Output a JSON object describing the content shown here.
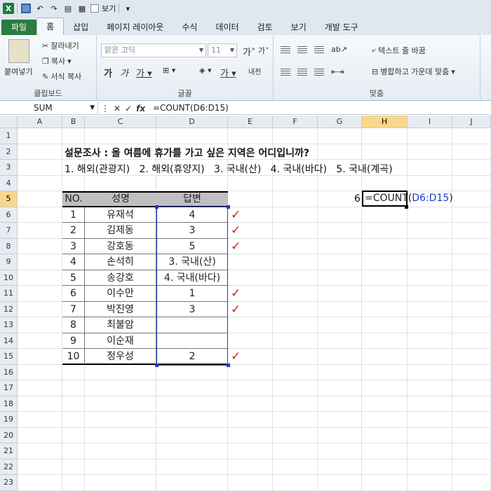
{
  "qat": {
    "view_label": "보기"
  },
  "tabs": [
    {
      "label": "파일",
      "active": false,
      "file": true
    },
    {
      "label": "홈",
      "active": true
    },
    {
      "label": "삽입"
    },
    {
      "label": "페이지 레이아웃"
    },
    {
      "label": "수식"
    },
    {
      "label": "데이터"
    },
    {
      "label": "검토"
    },
    {
      "label": "보기"
    },
    {
      "label": "개발 도구"
    }
  ],
  "ribbon": {
    "clipboard": {
      "paste": "붙여넣기",
      "cut": "잘라내기",
      "copy": "복사",
      "format_painter": "서식 복사",
      "group": "클립보드"
    },
    "font": {
      "name": "맑은 고딕",
      "size": "11",
      "group": "글꼴"
    },
    "align": {
      "wrap": "텍스트 줄 바꿈",
      "merge": "병합하고 가운데 맞춤",
      "group": "맞춤"
    }
  },
  "formula_bar": {
    "name_box": "SUM",
    "formula": "=COUNT(D6:D15)"
  },
  "columns": [
    "A",
    "B",
    "C",
    "D",
    "E",
    "F",
    "G",
    "H",
    "I",
    "J"
  ],
  "selected_column": "H",
  "selected_row": "5",
  "rows": [
    "1",
    "2",
    "3",
    "4",
    "5",
    "6",
    "7",
    "8",
    "9",
    "10",
    "11",
    "12",
    "13",
    "14",
    "15",
    "16",
    "17",
    "18",
    "19",
    "20",
    "21",
    "22",
    "23"
  ],
  "sheet": {
    "title": "설문조사 : 올 여름에 휴가를 가고 싶은 지역은 어디입니까?",
    "options": "1. 해외(관광지)   2. 해외(휴양지)   3. 국내(산)   4. 국내(바다)   5. 국내(계곡)",
    "headers": [
      "NO.",
      "성명",
      "답변"
    ],
    "table": [
      {
        "no": "1",
        "name": "유재석",
        "answer": "4",
        "check": true
      },
      {
        "no": "2",
        "name": "김제동",
        "answer": "3",
        "check": true
      },
      {
        "no": "3",
        "name": "강호동",
        "answer": "5",
        "check": true
      },
      {
        "no": "4",
        "name": "손석히",
        "answer": "3. 국내(산)",
        "check": false
      },
      {
        "no": "5",
        "name": "송강호",
        "answer": "4. 국내(바다)",
        "check": false
      },
      {
        "no": "6",
        "name": "이수만",
        "answer": "1",
        "check": true
      },
      {
        "no": "7",
        "name": "박진영",
        "answer": "3",
        "check": true
      },
      {
        "no": "8",
        "name": "최불암",
        "answer": "",
        "check": false
      },
      {
        "no": "9",
        "name": "이순재",
        "answer": "",
        "check": false
      },
      {
        "no": "10",
        "name": "정우성",
        "answer": "2",
        "check": true
      }
    ],
    "g5_value": "6",
    "h5_formula_prefix": "=COUNT(",
    "h5_formula_ref": "D6:D15",
    "h5_formula_suffix": ")",
    "check_mark": "✓"
  },
  "colors": {
    "accent": "#1d3ccf",
    "check": "#e0141e",
    "header_fill": "#bfbfbf",
    "file_tab": "#2a7c3f"
  }
}
